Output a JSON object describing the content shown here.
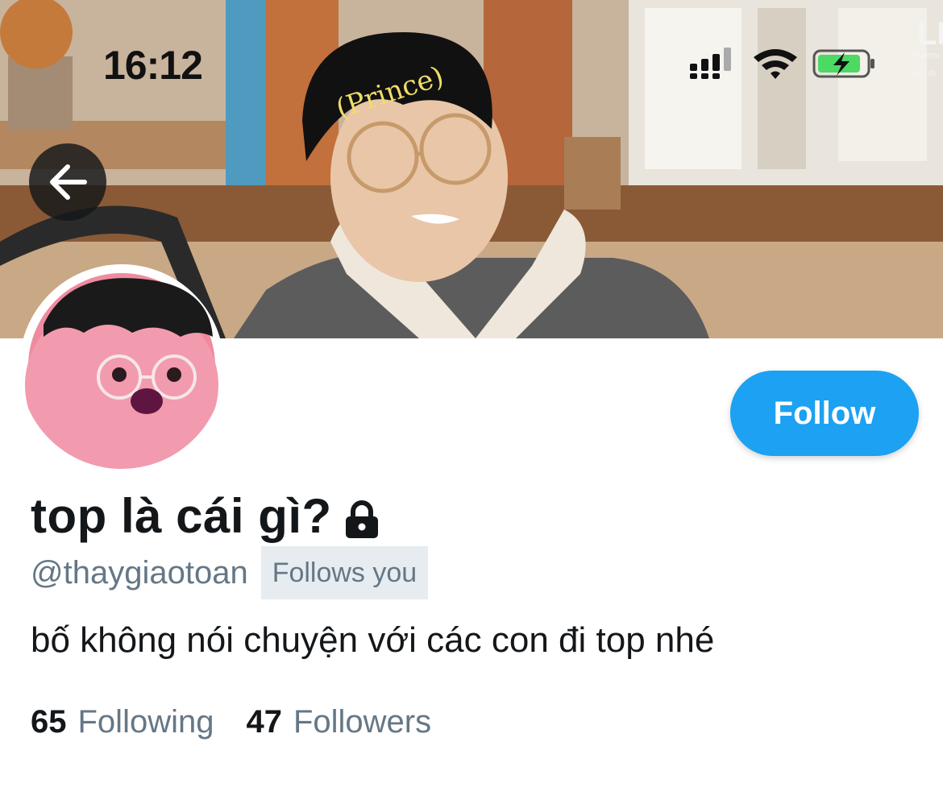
{
  "status_bar": {
    "time": "16:12",
    "icons": [
      "cellular-signal-icon",
      "wifi-icon",
      "battery-charging-icon"
    ]
  },
  "banner": {
    "overlay_text": "(Prince)",
    "corner_logo_text": "LE",
    "corner_logo_sub1": "Esports",
    "corner_logo_sub2": "he Life"
  },
  "profile": {
    "display_name": "top là cái gì?",
    "handle": "@thaygiaotoan",
    "follows_you_badge": "Follows you",
    "bio": "bố không nói chuyện với các con đi top nhé",
    "protected": true
  },
  "actions": {
    "follow_label": "Follow"
  },
  "stats": {
    "following_count": "65",
    "following_label": "Following",
    "followers_count": "47",
    "followers_label": "Followers"
  },
  "colors": {
    "accent": "#1da1f2",
    "secondary_text": "#657786",
    "badge_bg": "#e6ecf0",
    "primary_text": "#14171a"
  }
}
